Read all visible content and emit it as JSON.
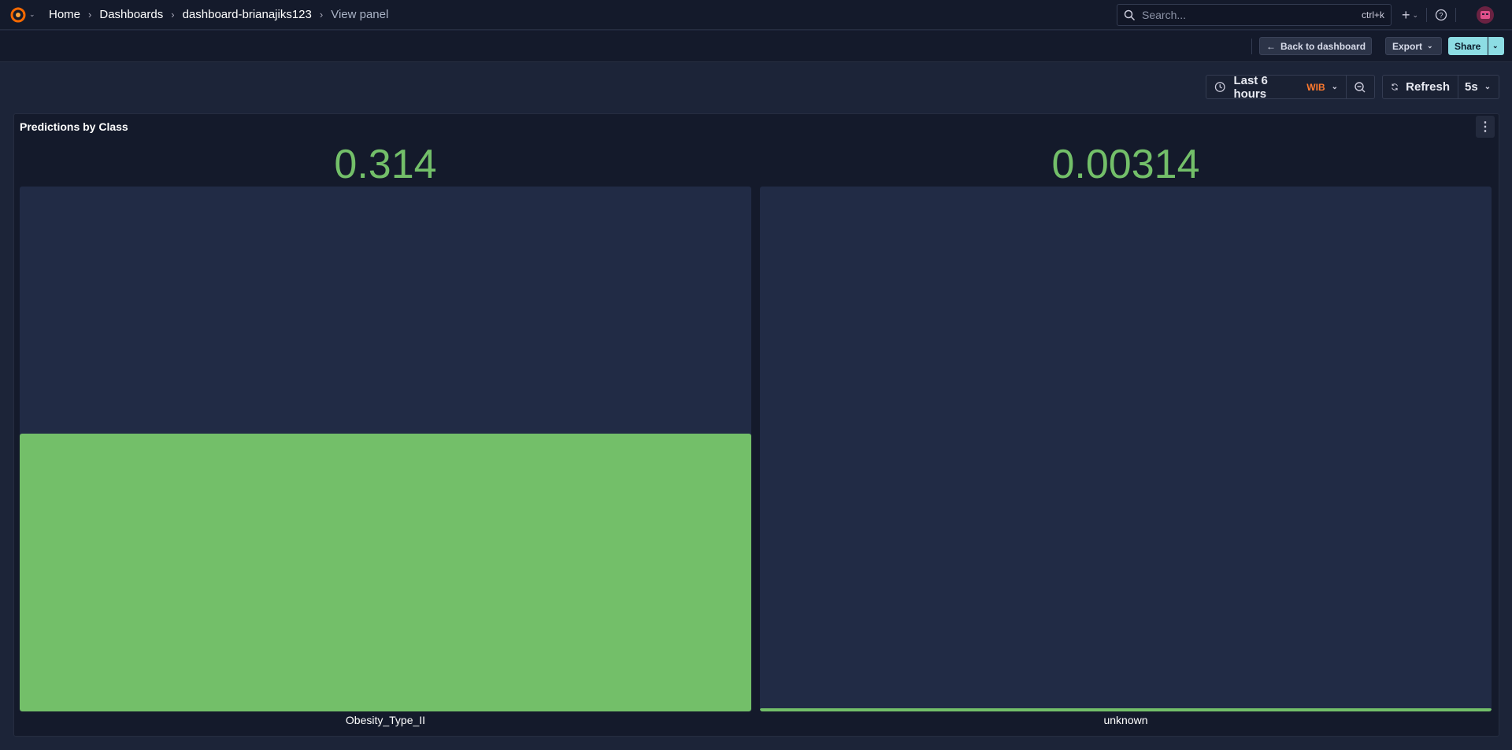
{
  "breadcrumb": [
    "Home",
    "Dashboards",
    "dashboard-brianajiks123",
    "View panel"
  ],
  "search": {
    "placeholder": "Search...",
    "shortcut": "ctrl+k"
  },
  "toolbar": {
    "back_label": "Back to dashboard",
    "export_label": "Export",
    "share_label": "Share"
  },
  "time": {
    "range_label": "Last 6 hours",
    "timezone": "WIB",
    "refresh_label": "Refresh",
    "refresh_interval": "5s"
  },
  "panel": {
    "title": "Predictions by Class",
    "gauges": [
      {
        "label": "Obesity_Type_II",
        "value_text": "0.314",
        "fill_fraction": 0.314
      },
      {
        "label": "unknown",
        "value_text": "0.00314",
        "fill_fraction": 0.00314
      }
    ]
  },
  "colors": {
    "accent_green": "#73bf69",
    "share_button": "#8ddde4",
    "timezone_orange": "#ff7a2e",
    "logo_orange": "#f46800"
  }
}
